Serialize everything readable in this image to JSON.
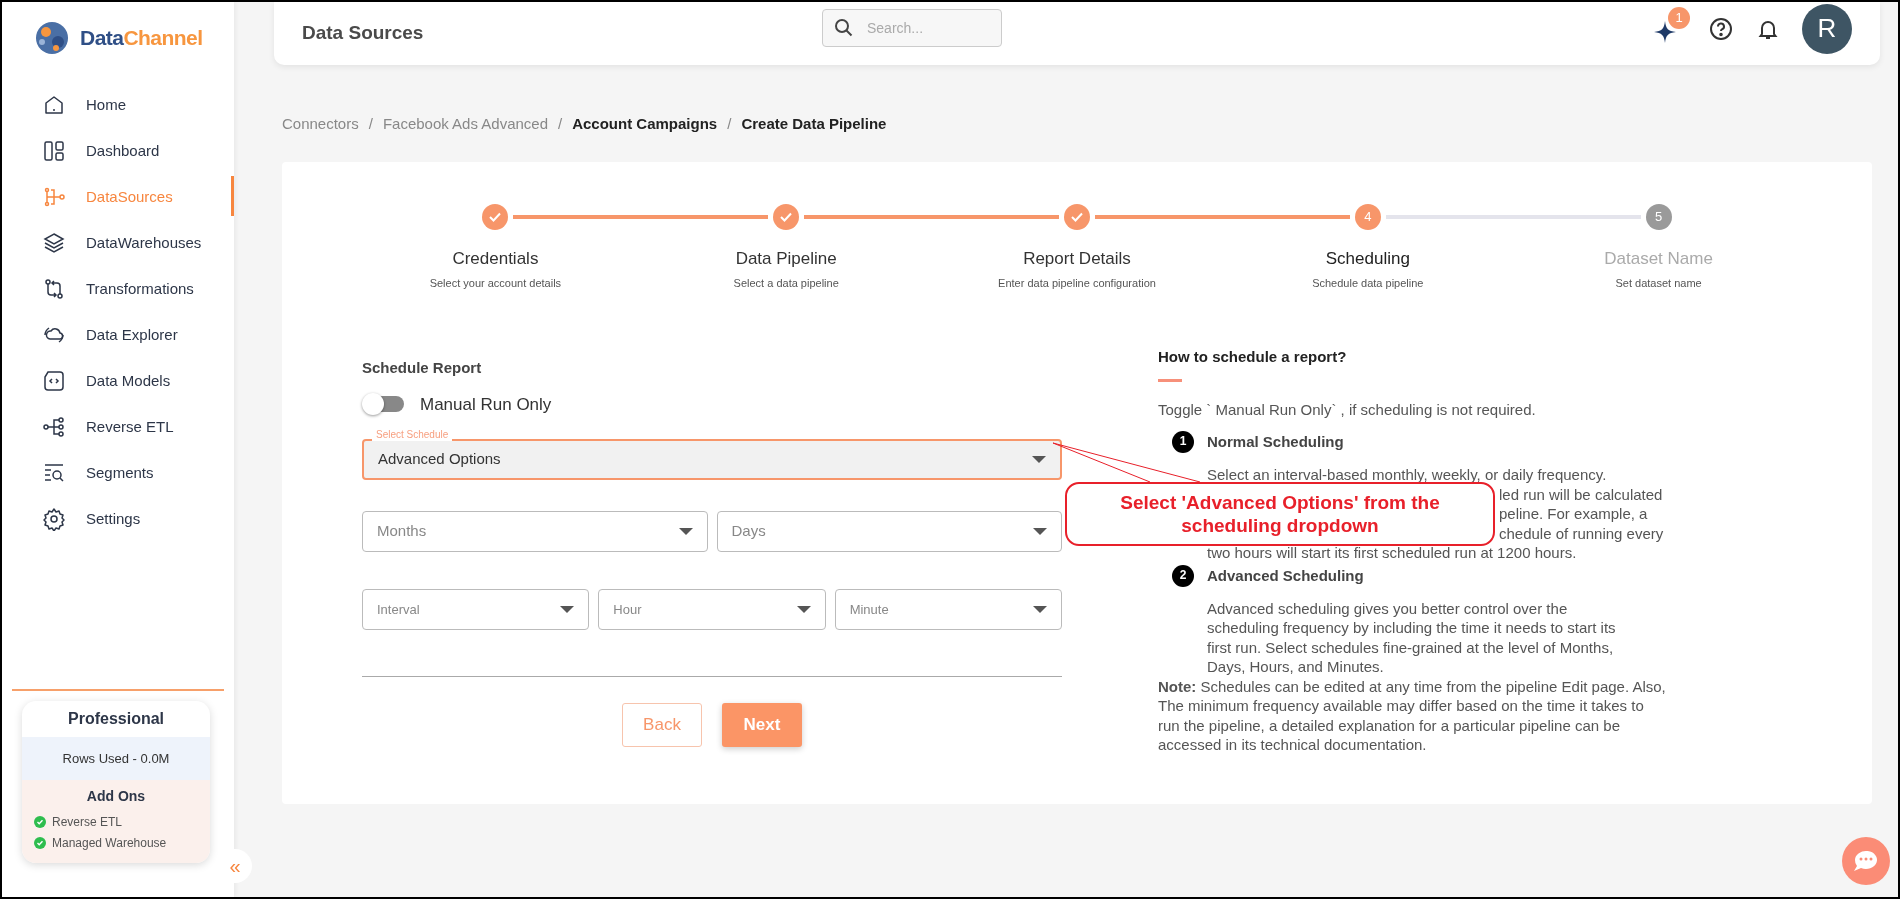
{
  "brand": {
    "name_first": "Data",
    "name_second": "Channel"
  },
  "sidebar": {
    "items": [
      {
        "label": "Home",
        "selected": false
      },
      {
        "label": "Dashboard",
        "selected": false
      },
      {
        "label": "DataSources",
        "selected": true
      },
      {
        "label": "DataWarehouses",
        "selected": false
      },
      {
        "label": "Transformations",
        "selected": false
      },
      {
        "label": "Data Explorer",
        "selected": false
      },
      {
        "label": "Data Models",
        "selected": false
      },
      {
        "label": "Reverse ETL",
        "selected": false
      },
      {
        "label": "Segments",
        "selected": false
      },
      {
        "label": "Settings",
        "selected": false
      }
    ]
  },
  "plan": {
    "name": "Professional",
    "usage": "Rows Used - 0.0M",
    "addons_title": "Add Ons",
    "addons": [
      {
        "label": "Reverse ETL",
        "enabled": true
      },
      {
        "label": "Managed Warehouse",
        "enabled": true
      }
    ]
  },
  "collapse": "«",
  "header": {
    "title": "Data Sources",
    "search_placeholder": "Search...",
    "notification_count": "1",
    "avatar": "R"
  },
  "breadcrumb": [
    {
      "kind": "link",
      "label": "Connectors"
    },
    {
      "kind": "separator",
      "label": "/"
    },
    {
      "kind": "link",
      "label": "Facebook Ads Advanced"
    },
    {
      "kind": "separator",
      "label": "/"
    },
    {
      "kind": "current",
      "label": "Account Campaigns"
    },
    {
      "kind": "separator",
      "label": "/"
    },
    {
      "kind": "current",
      "label": "Create Data Pipeline"
    }
  ],
  "steps": [
    {
      "title": "Credentials",
      "subtitle": "Select your account details",
      "done": true,
      "current": false
    },
    {
      "title": "Data Pipeline",
      "subtitle": "Select a data pipeline",
      "done": true,
      "current": false
    },
    {
      "title": "Report Details",
      "subtitle": "Enter data pipeline configuration",
      "done": true,
      "current": false
    },
    {
      "title": "Scheduling",
      "subtitle": "Schedule data pipeline",
      "done": false,
      "current": true,
      "number": "4"
    },
    {
      "title": "Dataset Name",
      "subtitle": "Set dataset name",
      "done": false,
      "current": false,
      "number": "5"
    }
  ],
  "form": {
    "title": "Schedule Report",
    "manual_toggle": {
      "label": "Manual Run Only",
      "on": false
    },
    "schedule_select": {
      "label": "Select Schedule",
      "value": "Advanced Options"
    },
    "rows": [
      [
        {
          "placeholder": "Months"
        },
        {
          "placeholder": "Days"
        }
      ],
      [
        {
          "placeholder": "Interval"
        },
        {
          "placeholder": "Hour"
        },
        {
          "placeholder": "Minute"
        }
      ]
    ],
    "buttons": [
      {
        "label": "Back",
        "kind": "secondary"
      },
      {
        "label": "Next",
        "kind": "primary"
      }
    ]
  },
  "help": {
    "title": "How to schedule a report?",
    "intro": "Toggle ` Manual Run Only` , if scheduling is not required.",
    "items": [
      {
        "number": "1",
        "title": "Normal Scheduling",
        "lines": [
          "Select an interval-based monthly, weekly, or daily frequency."
        ],
        "beside_callout": [
          "led run will be calculated",
          "peline. For example, a",
          "chedule of running every"
        ],
        "lines_after": [
          "two hours will start its first scheduled run at 1200 hours."
        ]
      },
      {
        "number": "2",
        "title": "Advanced Scheduling",
        "lines": [
          "Advanced scheduling gives you better control over the",
          "scheduling frequency by including the time it needs to start its",
          "first run. Select schedules fine-grained at the level of Months,",
          "Days, Hours, and Minutes."
        ]
      }
    ],
    "note": "**Note:** Schedules can be edited at any time from the pipeline Edit page. Also, The minimum frequency available may differ based on the time it takes to run the pipeline, a detailed explanation for a particular pipeline can be accessed in its technical documentation."
  },
  "callout": "Select 'Advanced Options' from the scheduling dropdown"
}
